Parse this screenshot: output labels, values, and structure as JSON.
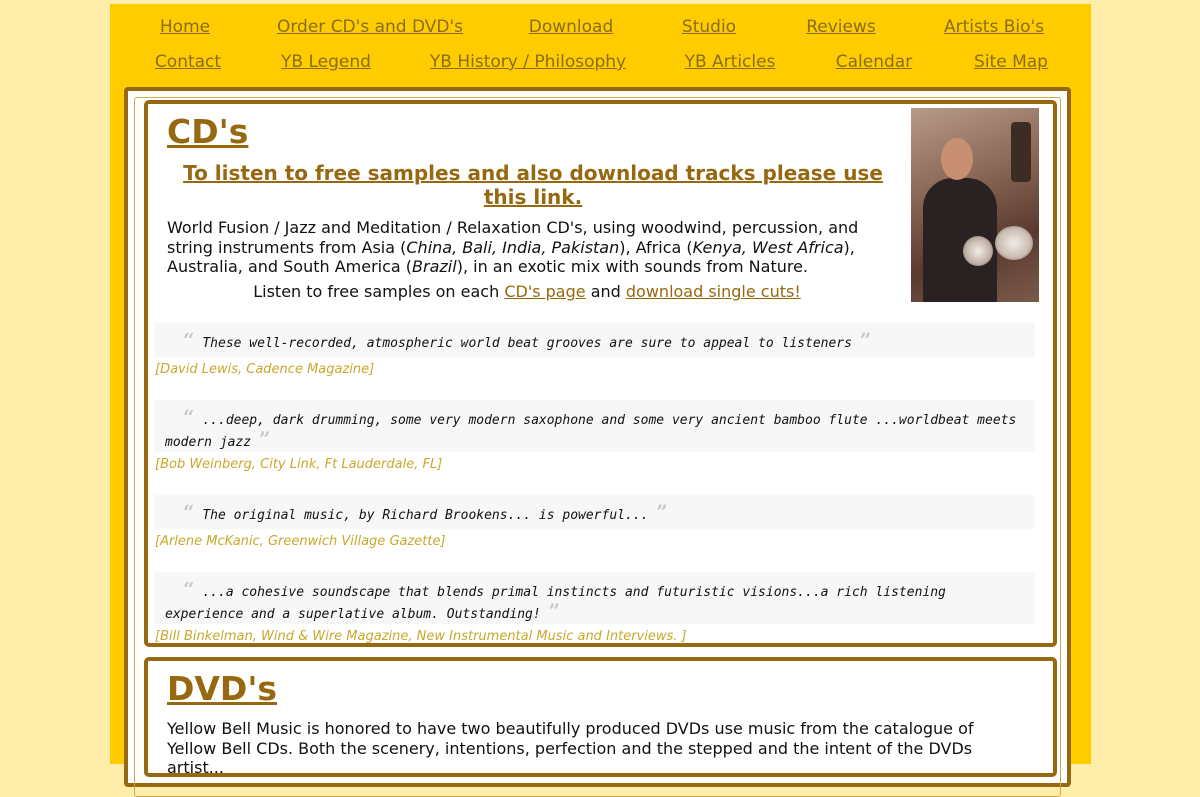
{
  "nav": {
    "row1": [
      "Home",
      "Order CD's and DVD's",
      "Download",
      "Studio",
      "Reviews",
      "Artists Bio's"
    ],
    "row2": [
      "Contact",
      "YB Legend",
      "YB History / Philosophy",
      "YB Articles",
      "Calendar",
      "Site Map"
    ]
  },
  "cds": {
    "heading": "CD's",
    "listen_link": "To listen to free samples and also download tracks please use this link.",
    "desc_1": "World Fusion / Jazz and Meditation / Relaxation CD's, using woodwind, percussion, and string instruments from Asia (",
    "desc_asia": "China, Bali, India, Pakistan",
    "desc_2": "), Africa (",
    "desc_africa": "Kenya, West Africa",
    "desc_3": "), Australia, and South America (",
    "desc_sa": "Brazil",
    "desc_4": "), in an exotic mix with sounds from Nature.",
    "samples_prefix": "Listen to free samples on each ",
    "cd_page_link": "CD's page",
    "samples_and": " and ",
    "download_link": "download single cuts!"
  },
  "quotes": [
    {
      "text": "These well-recorded, atmospheric world beat grooves are sure to appeal to listeners",
      "source": "[David Lewis, Cadence Magazine]"
    },
    {
      "text": "...deep, dark drumming, some very modern saxophone and some very ancient bamboo flute ...worldbeat meets modern jazz",
      "source": "[Bob Weinberg, City Link, Ft Lauderdale, FL]"
    },
    {
      "text": "The original music, by Richard Brookens... is powerful...",
      "source": "[Arlene McKanic, Greenwich Village Gazette]"
    },
    {
      "text": "...a cohesive soundscape that blends primal instincts and futuristic visions...a rich listening experience and a superlative album. Outstanding!",
      "source": "[Bill Binkelman, Wind & Wire Magazine, New Instrumental Music and Interviews. ]"
    }
  ],
  "quote_marks": {
    "open": "“",
    "close": "”"
  },
  "dvds": {
    "heading": "DVD's",
    "text": "Yellow Bell Music is honored to have two beautifully produced DVDs use music from the catalogue of Yellow Bell CDs. Both the scenery, intentions, perfection and the stepped and the intent of the DVDs artist..."
  },
  "colors": {
    "background": "#ffeeaa",
    "frame": "#ffcc00",
    "accent": "#96680f",
    "source": "#c8a82c"
  }
}
